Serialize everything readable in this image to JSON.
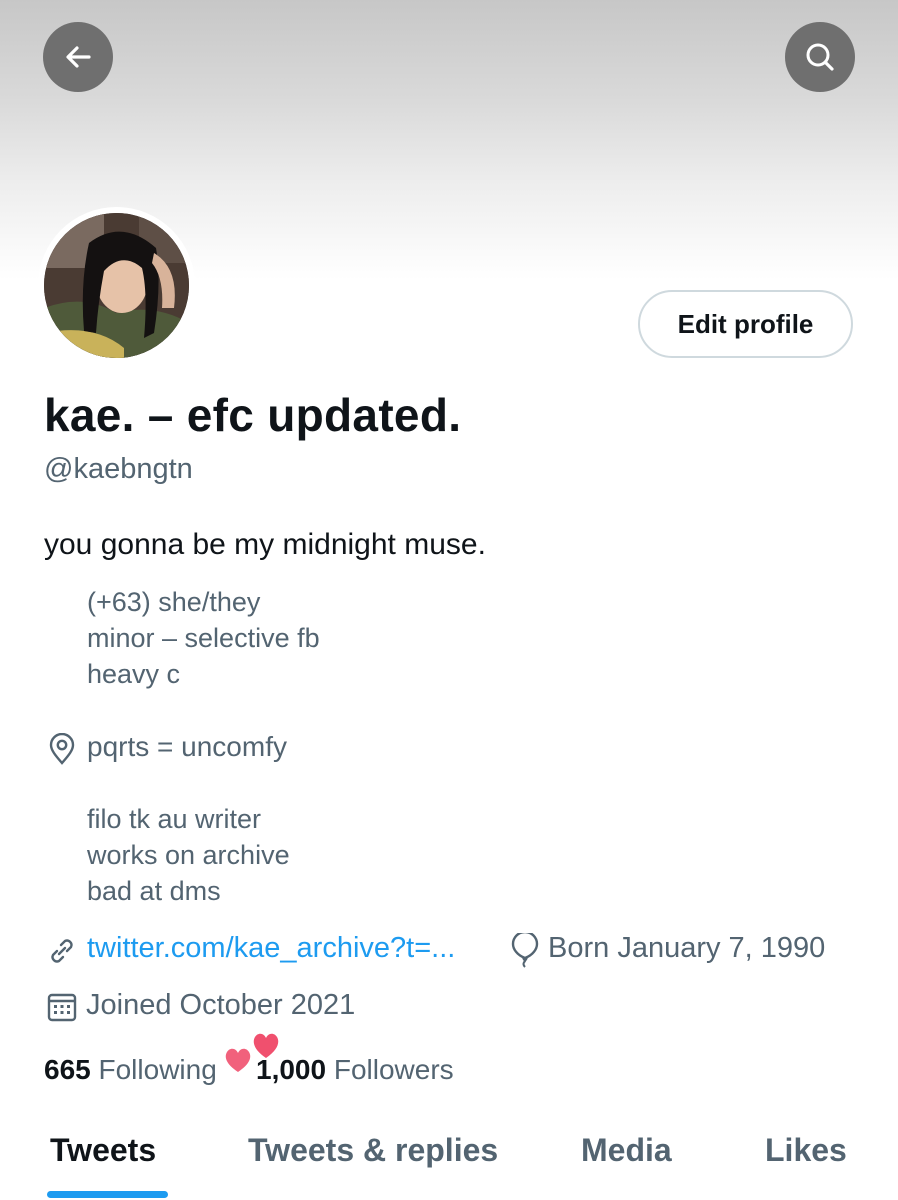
{
  "header": {
    "back_icon": "arrow-left-icon",
    "search_icon": "search-icon"
  },
  "profile": {
    "display_name": "kae. – efc updated.",
    "handle": "@kaebngtn",
    "edit_button": "Edit profile",
    "bio": {
      "main": "you gonna be my midnight muse.",
      "lines": [
        "(+63) she/they",
        "minor – selective fb",
        "heavy c",
        "pqrts = uncomfy",
        "filo tk au writer",
        "works on archive",
        "bad at dms"
      ]
    },
    "website": "twitter.com/kae_archive?t=...",
    "born": "Born January 7, 1990",
    "joined": "Joined October 2021",
    "following_count": "665",
    "following_label": "Following",
    "followers_count": "1,000",
    "followers_label": "Followers"
  },
  "tabs": [
    {
      "label": "Tweets",
      "active": true
    },
    {
      "label": "Tweets & replies",
      "active": false
    },
    {
      "label": "Media",
      "active": false
    },
    {
      "label": "Likes",
      "active": false
    }
  ],
  "colors": {
    "accent": "#1d9bf0",
    "text_primary": "#0f1419",
    "text_secondary": "#536471",
    "heart": "#f0506e"
  }
}
